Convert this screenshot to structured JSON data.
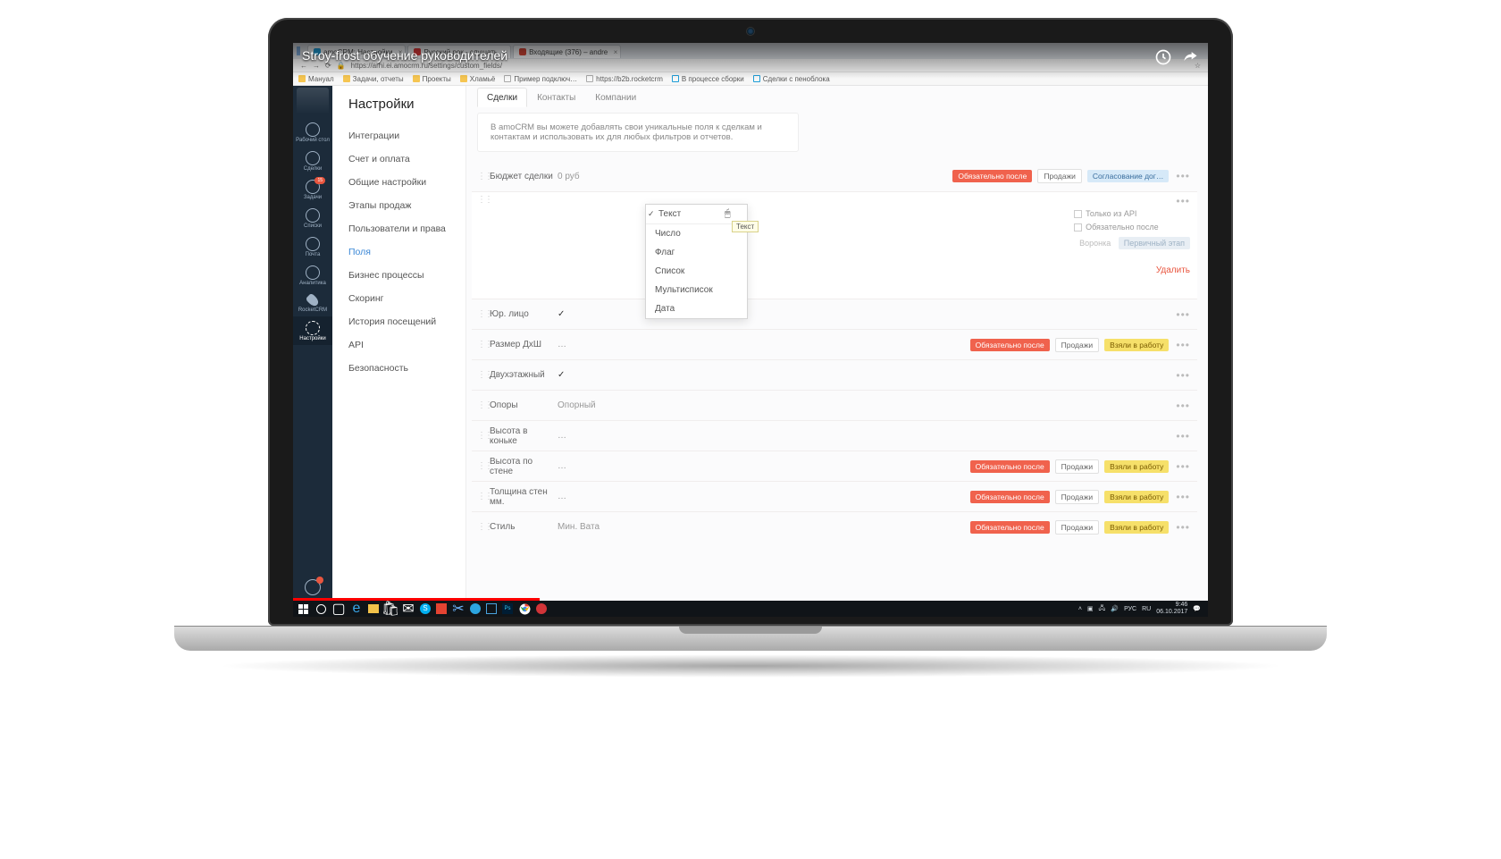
{
  "youtube": {
    "title": "Stroy-frost обучение руководителей"
  },
  "browser": {
    "tabs": [
      {
        "label": "аmoCRM: Настройки",
        "fav": "#1f9dd8"
      },
      {
        "label": "Русский рок - слушать",
        "fav": "#e03a3a"
      },
      {
        "label": "Входящие (376) – andre",
        "fav": "#d44638"
      }
    ],
    "url": "https://arhi.ei.amocrm.ru/settings/custom_fields/",
    "bookmarks": [
      "Мануал",
      "Задачи, отчеты",
      "Проекты",
      "Хламьё",
      "Пример подключ…",
      "https://b2b.rocketcrm",
      "В процессе сборки",
      "Сделки с пеноблока"
    ]
  },
  "leftnav": {
    "items": [
      {
        "key": "desktop",
        "label": "Рабочий стол"
      },
      {
        "key": "deals",
        "label": "Сделки"
      },
      {
        "key": "tasks",
        "label": "Задачи",
        "badge": "15"
      },
      {
        "key": "lists",
        "label": "Списки"
      },
      {
        "key": "mail",
        "label": "Почта"
      },
      {
        "key": "analytics",
        "label": "Аналитика"
      },
      {
        "key": "rocketcrm",
        "label": "RocketCRM"
      },
      {
        "key": "settings",
        "label": "Настройки"
      }
    ]
  },
  "subnav": {
    "title": "Настройки",
    "items": [
      "Интеграции",
      "Счет и оплата",
      "Общие настройки",
      "Этапы продаж",
      "Пользователи и права",
      "Поля",
      "Бизнес процессы",
      "Скоринг",
      "История посещений",
      "API",
      "Безопасность"
    ],
    "active": "Поля"
  },
  "content": {
    "tabs": [
      "Сделки",
      "Контакты",
      "Компании"
    ],
    "active_tab": "Сделки",
    "intro": "В amoCRM вы можете добавлять свои уникальные поля к сделкам и контактам и использовать их для любых фильтров и отчетов.",
    "fields": [
      {
        "name": "Бюджет сделки",
        "value": "0 руб",
        "tags": [
          {
            "t": "Обязательно после",
            "c": "red"
          },
          {
            "t": "Продажи",
            "c": "white"
          },
          {
            "t": "Согласование дог…",
            "c": "blue"
          }
        ]
      },
      {
        "name": "",
        "value": "",
        "dropdown": true
      },
      {
        "name": "Юр. лицо",
        "value": "✓"
      },
      {
        "name": "Размер ДхШ",
        "value": "…",
        "tags": [
          {
            "t": "Обязательно после",
            "c": "red"
          },
          {
            "t": "Продажи",
            "c": "white"
          },
          {
            "t": "Взяли в работу",
            "c": "yellow"
          }
        ]
      },
      {
        "name": "Двухэтажный",
        "value": "✓"
      },
      {
        "name": "Опоры",
        "value": "Опорный"
      },
      {
        "name": "Высота в коньке",
        "value": "…"
      },
      {
        "name": "Высота по стене",
        "value": "…",
        "tags": [
          {
            "t": "Обязательно после",
            "c": "red"
          },
          {
            "t": "Продажи",
            "c": "white"
          },
          {
            "t": "Взяли в работу",
            "c": "yellow"
          }
        ]
      },
      {
        "name": "Толщина стен мм.",
        "value": "…",
        "tags": [
          {
            "t": "Обязательно после",
            "c": "red"
          },
          {
            "t": "Продажи",
            "c": "white"
          },
          {
            "t": "Взяли в работу",
            "c": "yellow"
          }
        ]
      },
      {
        "name": "Стиль",
        "value": "Мин. Вата",
        "tags": [
          {
            "t": "Обязательно после",
            "c": "red"
          },
          {
            "t": "Продажи",
            "c": "white"
          },
          {
            "t": "Взяли в работу",
            "c": "yellow"
          }
        ]
      }
    ],
    "dropdown": {
      "options": [
        "Текст",
        "Число",
        "Флаг",
        "Список",
        "Мультисписок",
        "Дата"
      ],
      "selected": "Текст",
      "tooltip": "Текст"
    },
    "side": {
      "api": "Только из API",
      "required": "Обязательно после",
      "pipeline_left": "Воронка",
      "pipeline_right": "Первичный этап",
      "delete": "Удалить"
    }
  },
  "taskbar": {
    "lang": "РУС",
    "kb": "RU",
    "time": "9:46",
    "date": "06.10.2017"
  }
}
